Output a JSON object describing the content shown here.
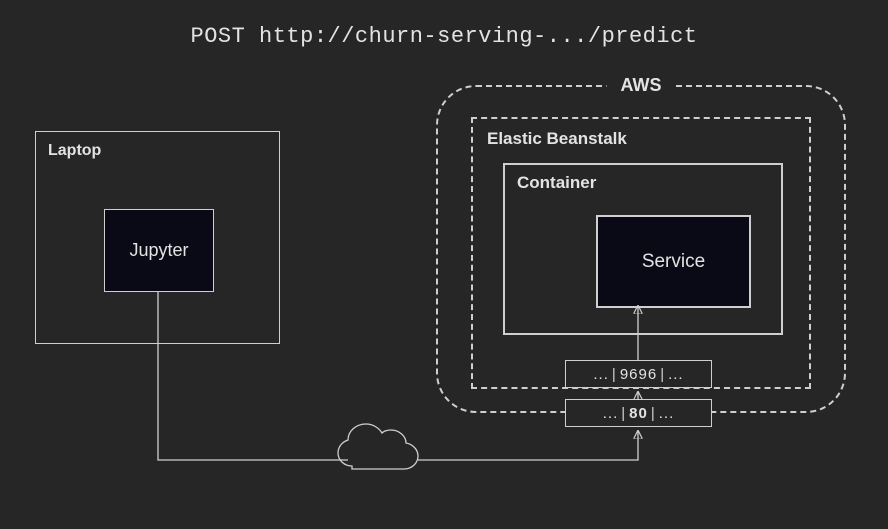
{
  "title": "POST http://churn-serving-.../predict",
  "laptop": {
    "label": "Laptop",
    "jupyter": "Jupyter"
  },
  "aws": {
    "label": "AWS",
    "eb": {
      "label": "Elastic Beanstalk",
      "container": {
        "label": "Container",
        "service": "Service"
      }
    },
    "port_inner": {
      "left": "...",
      "value": "9696",
      "right": "..."
    },
    "port_outer": {
      "left": "...",
      "value": "80",
      "right": "..."
    }
  },
  "colors": {
    "bg": "#262626",
    "line": "#cfcfcf",
    "dark": "#0a0a17",
    "text": "#e3e3e3"
  }
}
